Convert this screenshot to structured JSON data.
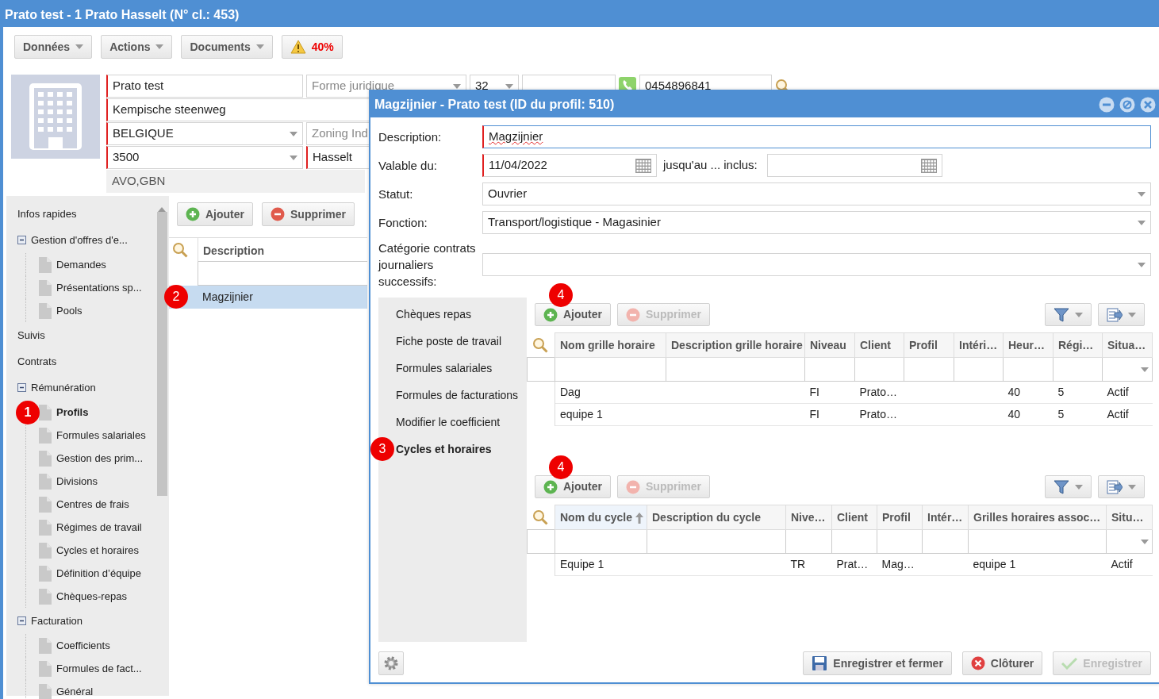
{
  "window": {
    "title": "Prato test - 1 Prato Hasselt (N° cl.: 453)"
  },
  "toolbar": {
    "menus": [
      "Données",
      "Actions",
      "Documents"
    ],
    "warning": "40%"
  },
  "company_form": {
    "rows": [
      [
        {
          "kind": "text",
          "value": "Prato test",
          "required": true
        },
        {
          "kind": "select",
          "placeholder": "Forme juridique"
        },
        {
          "kind": "select",
          "value": "32"
        },
        {
          "kind": "text"
        },
        {
          "kind": "phone"
        },
        {
          "kind": "text",
          "value": "0454896841"
        },
        {
          "kind": "search"
        }
      ],
      [
        {
          "kind": "text",
          "value": "Kempische steenweg",
          "required": true
        }
      ],
      [
        {
          "kind": "select",
          "value": "BELGIQUE",
          "required": true
        },
        {
          "kind": "text",
          "placeholder": "Zoning Ind"
        }
      ],
      [
        {
          "kind": "select",
          "value": "3500",
          "required": true
        },
        {
          "kind": "text",
          "value": "Hasselt",
          "required": true
        }
      ],
      [
        {
          "kind": "readonly",
          "value": "AVO,GBN"
        }
      ]
    ]
  },
  "navigation": {
    "items": [
      {
        "kind": "link",
        "label": "Infos rapides"
      },
      {
        "kind": "group",
        "label": "Gestion d'offres d'e...",
        "expanded": true,
        "children": [
          {
            "label": "Demandes",
            "selected": false
          },
          {
            "label": "Présentations sp...",
            "selected": false
          },
          {
            "label": "Pools",
            "selected": false
          }
        ]
      },
      {
        "kind": "link",
        "label": "Suivis"
      },
      {
        "kind": "link",
        "label": "Contrats"
      },
      {
        "kind": "group",
        "label": "Rémunération",
        "expanded": true,
        "children": [
          {
            "label": "Profils",
            "selected": true,
            "marker": "1"
          },
          {
            "label": "Formules salariales",
            "selected": false
          },
          {
            "label": "Gestion des prim...",
            "selected": false
          },
          {
            "label": "Divisions",
            "selected": false
          },
          {
            "label": "Centres de frais",
            "selected": false
          },
          {
            "label": "Régimes de travail",
            "selected": false
          },
          {
            "label": "Cycles et horaires",
            "selected": false
          },
          {
            "label": "Définition d’équipe",
            "selected": false
          },
          {
            "label": "Chèques-repas",
            "selected": false
          }
        ]
      },
      {
        "kind": "group",
        "label": "Facturation",
        "expanded": true,
        "children": [
          {
            "label": "Coefficients",
            "selected": false
          },
          {
            "label": "Formules de fact...",
            "selected": false
          },
          {
            "label": "Général",
            "selected": false
          }
        ]
      }
    ]
  },
  "profiles": {
    "add": "Ajouter",
    "remove": "Supprimer",
    "columns": [
      "Description"
    ],
    "rows": [
      {
        "description": "Magzijnier",
        "selected": true,
        "marker": "2"
      }
    ]
  },
  "dialog": {
    "title": "Magzijnier - Prato test (ID du profil: 510)",
    "fields": {
      "description_label": "Description:",
      "description": "Magzijnier",
      "valid_from_label": "Valable du:",
      "valid_from": "11/04/2022",
      "valid_to_label": "jusqu'au ... inclus:",
      "status_label": "Statut:",
      "status": "Ouvrier",
      "function_label": "Fonction:",
      "function": "Transport/logistique - Magasinier",
      "category_label": "Catégorie contrats journaliers successifs:"
    },
    "tabs": [
      {
        "label": "Chèques repas",
        "selected": false
      },
      {
        "label": "Fiche poste de travail",
        "selected": false
      },
      {
        "label": "Formules salariales",
        "selected": false
      },
      {
        "label": "Formules de facturations",
        "selected": false
      },
      {
        "label": "Modifier le coefficient",
        "selected": false
      },
      {
        "label": "Cycles et horaires",
        "selected": true,
        "marker": "3"
      }
    ],
    "grids": [
      {
        "add": "Ajouter",
        "remove": "Supprimer",
        "remove_disabled": true,
        "marker": "4",
        "columns": [
          {
            "label": "Nom grille horaire",
            "sorted": false
          },
          {
            "label": "Description grille horaire",
            "sorted": false
          },
          {
            "label": "Niveau",
            "sorted": false
          },
          {
            "label": "Client",
            "sorted": false
          },
          {
            "label": "Profil",
            "sorted": false
          },
          {
            "label": "Intéri…",
            "sorted": false
          },
          {
            "label": "Heur…",
            "sorted": false
          },
          {
            "label": "Régi…",
            "sorted": false
          },
          {
            "label": "Situa…",
            "sorted": false
          }
        ],
        "rows": [
          [
            "Dag",
            null,
            "FI",
            "Prato…",
            null,
            null,
            "40",
            "5",
            "Actif"
          ],
          [
            "equipe 1",
            null,
            "FI",
            "Prato…",
            null,
            null,
            "40",
            "5",
            "Actif"
          ]
        ]
      },
      {
        "add": "Ajouter",
        "remove": "Supprimer",
        "remove_disabled": true,
        "marker": "4",
        "columns": [
          {
            "label": "Nom du cycle",
            "sorted": true
          },
          {
            "label": "Description du cycle",
            "sorted": false
          },
          {
            "label": "Nive…",
            "sorted": false
          },
          {
            "label": "Client",
            "sorted": false
          },
          {
            "label": "Profil",
            "sorted": false
          },
          {
            "label": "Intér…",
            "sorted": false
          },
          {
            "label": "Grilles horaires assoc…",
            "sorted": false
          },
          {
            "label": "Situ…",
            "sorted": false
          }
        ],
        "rows": [
          [
            "Equipe 1",
            null,
            "TR",
            "Prat…",
            "Mag…",
            null,
            "equipe 1",
            "Actif"
          ]
        ]
      }
    ],
    "footer": [
      {
        "kind": "save-close",
        "label": "Enregistrer et fermer",
        "disabled": false
      },
      {
        "kind": "close",
        "label": "Clôturer",
        "disabled": false
      },
      {
        "kind": "save",
        "label": "Enregistrer",
        "disabled": true
      }
    ]
  }
}
